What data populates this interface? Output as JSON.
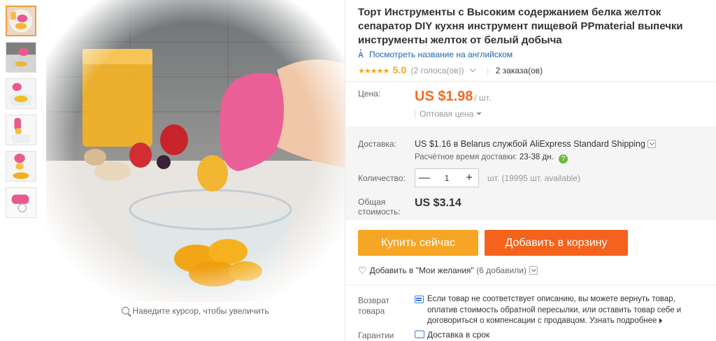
{
  "thumbnails": [
    {
      "name": "thumb-1",
      "active": true
    },
    {
      "name": "thumb-2",
      "active": false
    },
    {
      "name": "thumb-3",
      "active": false
    },
    {
      "name": "thumb-4",
      "active": false
    },
    {
      "name": "thumb-5",
      "active": false
    },
    {
      "name": "thumb-6",
      "active": false
    }
  ],
  "zoom_hint": "Наведите курсор, чтобы увеличить",
  "product": {
    "title": "Торт Инструменты с Высоким содержанием белка желток сепаратор DIY кухня инструмент пищевой PPmaterial выпечки инструменты желток от белый добыча",
    "translate_icon": "A̓",
    "translate_label": "Посмотреть название на английском",
    "stars": "★★★★★",
    "rating": "5.0",
    "votes": "(2 голоса(ов))",
    "orders": "2 заказа(ов)"
  },
  "price": {
    "label": "Цена:",
    "value": "US $1.98",
    "unit": "/ шт.",
    "wholesale": "Оптовая цена"
  },
  "shipping": {
    "label": "Доставка:",
    "text": "US $1.16 в Belarus службой AliExpress Standard Shipping",
    "time_label": "Расчётное время доставки:",
    "time_value": "23-38 дн.",
    "help": "?"
  },
  "quantity": {
    "label": "Количество:",
    "minus": "—",
    "value": "1",
    "plus": "+",
    "note": "шт. (19995 шт. available)"
  },
  "total": {
    "label": "Общая стоимость:",
    "value": "US $3.14"
  },
  "actions": {
    "buy_now": "Купить сейчас",
    "add_to_cart": "Добавить в корзину"
  },
  "wishlist": {
    "heart": "♡",
    "label": "Добавить в \"Мои желания\"",
    "count": "(6 добавили)"
  },
  "returns": {
    "label": "Возврат товара",
    "text": "Если товар не соответствует описанию, вы можете вернуть товар, оплатив стоимость обратной пересылки, или оставить товар себе и договориться о компенсации с продавцом.",
    "more": "Узнать подробнее"
  },
  "guarantee": {
    "label": "Гарантии",
    "text": "Доставка в срок"
  },
  "colors": {
    "price_orange": "#f56b1e",
    "buy_button": "#f7a524",
    "cart_button": "#f4621c",
    "star": "#f5a623",
    "link_blue": "#1a65b0"
  }
}
